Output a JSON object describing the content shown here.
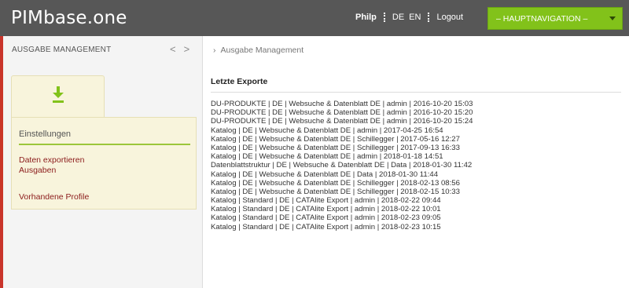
{
  "header": {
    "logo": "PIMbase.one",
    "user": "Philp",
    "lang_de": "DE",
    "lang_en": "EN",
    "logout": "Logout",
    "main_nav": "– HAUPTNAVIGATION –"
  },
  "sidebar": {
    "title": "AUSGABE MANAGEMENT",
    "prev": "<",
    "next": ">",
    "section_title": "Einstellungen",
    "links": [
      "Daten exportieren",
      "Ausgaben",
      "Vorhandene Profile"
    ],
    "accent_color": "#82c21a"
  },
  "breadcrumb": "Ausgabe Management",
  "main": {
    "title": "Letzte Exporte",
    "exports": [
      "DU-PRODUKTE | DE | Websuche & Datenblatt DE | admin | 2016-10-20 15:03",
      "DU-PRODUKTE | DE | Websuche & Datenblatt DE | admin | 2016-10-20 15:20",
      "DU-PRODUKTE | DE | Websuche & Datenblatt DE | admin | 2016-10-20 15:24",
      "Katalog | DE | Websuche & Datenblatt DE | admin | 2017-04-25 16:54",
      "Katalog | DE | Websuche & Datenblatt DE | Schillegger | 2017-05-16 12:27",
      "Katalog | DE | Websuche & Datenblatt DE | Schillegger | 2017-09-13 16:33",
      "Katalog | DE | Websuche & Datenblatt DE | admin | 2018-01-18 14:51",
      "Datenblattstruktur | DE | Websuche & Datenblatt DE | Data | 2018-01-30 11:42",
      "Katalog | DE | Websuche & Datenblatt DE | Data | 2018-01-30 11:44",
      "Katalog | DE | Websuche & Datenblatt DE | Schillegger | 2018-02-13 08:56",
      "Katalog | DE | Websuche & Datenblatt DE | Schillegger | 2018-02-15 10:33",
      "Katalog | Standard | DE | CATAlite Export | admin | 2018-02-22 09:44",
      "Katalog | Standard | DE | CATAlite Export | admin | 2018-02-22 10:01",
      "Katalog | Standard | DE | CATAlite Export | admin | 2018-02-23 09:05",
      "Katalog | Standard | DE | CATAlite Export | admin | 2018-02-23 10:15"
    ]
  }
}
